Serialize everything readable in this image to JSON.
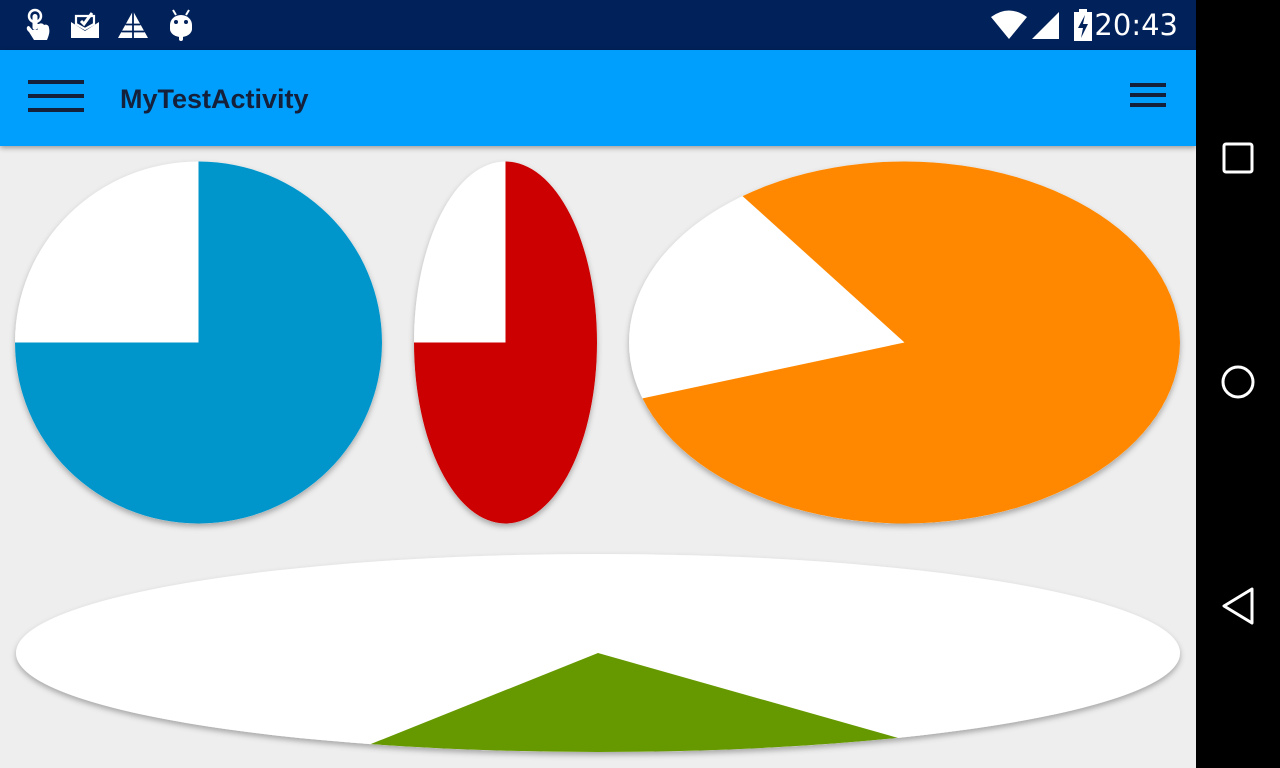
{
  "status_bar": {
    "time": "20:43",
    "left_icons": [
      "touch-hand-icon",
      "mail-check-icon",
      "triangle-grid-icon",
      "android-icon"
    ],
    "right_icons": [
      "wifi-icon",
      "cell-signal-icon",
      "battery-charging-icon"
    ],
    "background_color": "#00215a"
  },
  "app_bar": {
    "title": "MyTestActivity",
    "menu_icon": "hamburger-menu-icon",
    "overflow_icon": "overflow-menu-icon",
    "background_color": "#009ffe"
  },
  "pie_charts": [
    {
      "name": "blue-pie",
      "fill_fraction": 0.75,
      "color": "#0096cc",
      "empty_color": "#ffffff"
    },
    {
      "name": "red-pie",
      "fill_fraction": 0.75,
      "color": "#cc0000",
      "empty_color": "#ffffff"
    },
    {
      "name": "orange-pie",
      "fill_fraction": 0.8,
      "color": "#ff8800",
      "empty_color": "#ffffff"
    },
    {
      "name": "green-pie",
      "fill_fraction": 0.15,
      "color": "#669900",
      "empty_color": "#ffffff"
    }
  ],
  "nav_bar": {
    "buttons": [
      "recents-square-icon",
      "home-circle-icon",
      "back-triangle-icon"
    ]
  }
}
